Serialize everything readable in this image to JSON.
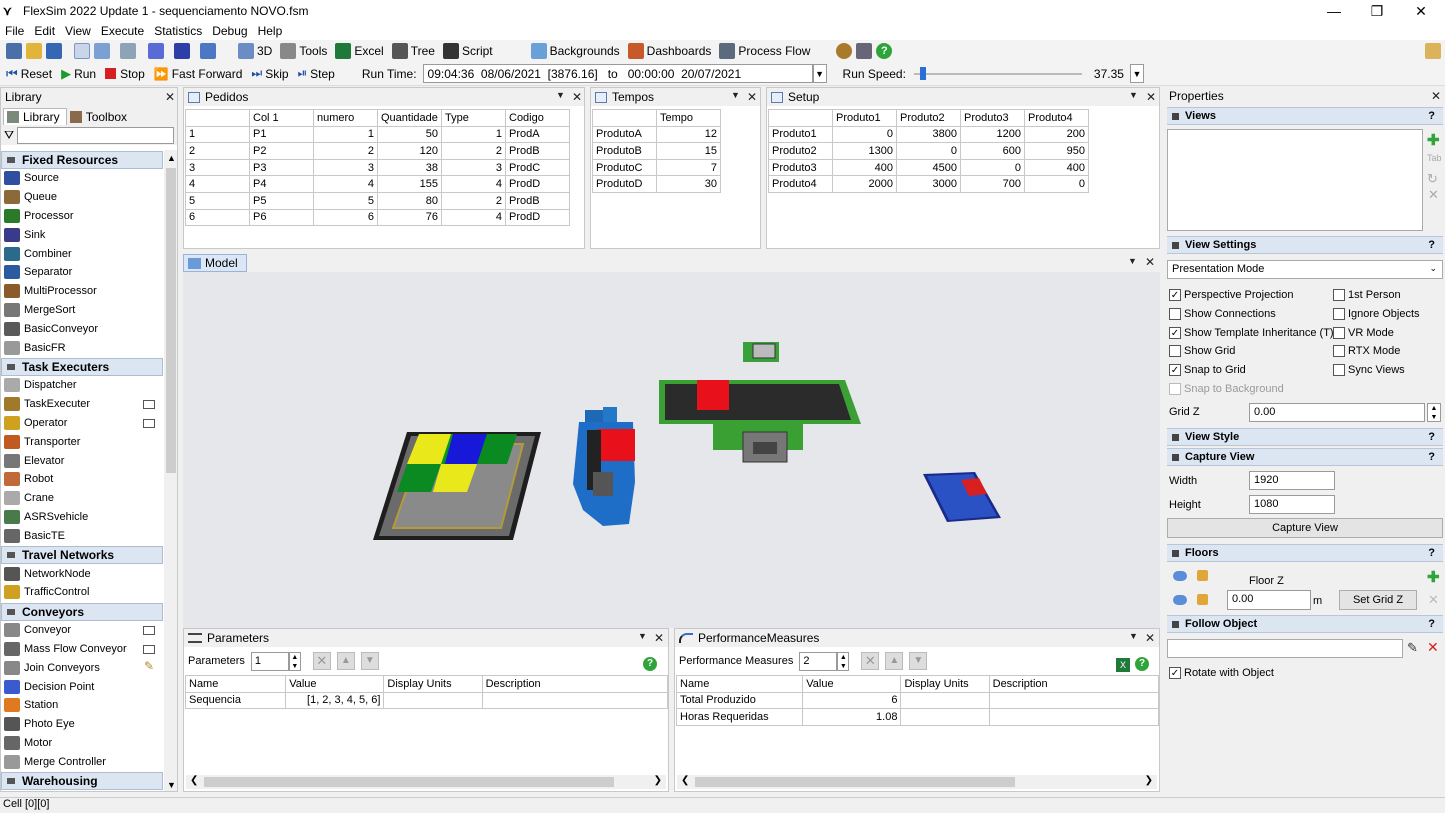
{
  "app": {
    "title": "FlexSim 2022 Update 1 - sequenciamento NOVO.fsm",
    "status": "Cell [0][0]"
  },
  "menu": [
    "File",
    "Edit",
    "View",
    "Execute",
    "Statistics",
    "Debug",
    "Help"
  ],
  "toolbar": {
    "btn_3d": "3D",
    "btn_tools": "Tools",
    "btn_excel": "Excel",
    "btn_tree": "Tree",
    "btn_script": "Script",
    "btn_backgrounds": "Backgrounds",
    "btn_dashboards": "Dashboards",
    "btn_process_flow": "Process Flow"
  },
  "runbar": {
    "reset": "Reset",
    "run": "Run",
    "stop": "Stop",
    "fast_forward": "Fast Forward",
    "skip": "Skip",
    "step": "Step",
    "run_time_label": "Run Time:",
    "run_time_value": "09:04:36  08/06/2021  [3876.16]   to   00:00:00  20/07/2021",
    "run_speed_label": "Run Speed:",
    "run_speed_value": "37.35",
    "run_speed_fraction": 0.04
  },
  "library": {
    "title": "Library",
    "tabs": [
      "Library",
      "Toolbox"
    ],
    "categories": [
      {
        "name": "Fixed Resources",
        "items": [
          "Source",
          "Queue",
          "Processor",
          "Sink",
          "Combiner",
          "Separator",
          "MultiProcessor",
          "MergeSort",
          "BasicConveyor",
          "BasicFR"
        ]
      },
      {
        "name": "Task Executers",
        "items": [
          "Dispatcher",
          "TaskExecuter",
          "Operator",
          "Transporter",
          "Elevator",
          "Robot",
          "Crane",
          "ASRSvehicle",
          "BasicTE"
        ]
      },
      {
        "name": "Travel Networks",
        "items": [
          "NetworkNode",
          "TrafficControl"
        ]
      },
      {
        "name": "Conveyors",
        "items": [
          "Conveyor",
          "Mass Flow Conveyor",
          "Join Conveyors",
          "Decision Point",
          "Station",
          "Photo Eye",
          "Motor",
          "Merge Controller"
        ]
      },
      {
        "name": "Warehousing",
        "items": []
      }
    ]
  },
  "pedidos": {
    "title": "Pedidos",
    "headers": [
      "",
      "Col 1",
      "numero",
      "Quantidade",
      "Type",
      "Codigo"
    ],
    "rows": [
      [
        "1",
        "P1",
        "1",
        "50",
        "1",
        "ProdA"
      ],
      [
        "2",
        "P2",
        "2",
        "120",
        "2",
        "ProdB"
      ],
      [
        "3",
        "P3",
        "3",
        "38",
        "3",
        "ProdC"
      ],
      [
        "4",
        "P4",
        "4",
        "155",
        "4",
        "ProdD"
      ],
      [
        "5",
        "P5",
        "5",
        "80",
        "2",
        "ProdB"
      ],
      [
        "6",
        "P6",
        "6",
        "76",
        "4",
        "ProdD"
      ]
    ]
  },
  "tempos": {
    "title": "Tempos",
    "headers": [
      "",
      "Tempo"
    ],
    "rows": [
      [
        "ProdutoA",
        "12"
      ],
      [
        "ProdutoB",
        "15"
      ],
      [
        "ProdutoC",
        "7"
      ],
      [
        "ProdutoD",
        "30"
      ]
    ]
  },
  "setup": {
    "title": "Setup",
    "headers": [
      "",
      "Produto1",
      "Produto2",
      "Produto3",
      "Produto4"
    ],
    "rows": [
      [
        "Produto1",
        "0",
        "3800",
        "1200",
        "200"
      ],
      [
        "Produto2",
        "1300",
        "0",
        "600",
        "950"
      ],
      [
        "Produto3",
        "400",
        "4500",
        "0",
        "400"
      ],
      [
        "Produto4",
        "2000",
        "3000",
        "700",
        "0"
      ]
    ]
  },
  "model": {
    "title": "Model"
  },
  "parameters": {
    "title": "Parameters",
    "label": "Parameters",
    "count": "1",
    "headers": [
      "Name",
      "Value",
      "Display Units",
      "Description"
    ],
    "rows": [
      [
        "Sequencia",
        "[1, 2, 3, 4, 5, 6]",
        "",
        ""
      ]
    ]
  },
  "performance": {
    "title": "PerformanceMeasures",
    "label": "Performance Measures",
    "count": "2",
    "headers": [
      "Name",
      "Value",
      "Display Units",
      "Description"
    ],
    "rows": [
      [
        "Total Produzido",
        "6",
        "",
        ""
      ],
      [
        "Horas Requeridas",
        "1.08",
        "",
        ""
      ]
    ]
  },
  "properties": {
    "title": "Properties",
    "views": "Views",
    "view_settings": "View Settings",
    "mode": "Presentation Mode",
    "checks_left": [
      {
        "label": "Perspective Projection",
        "checked": true
      },
      {
        "label": "Show Connections",
        "checked": false
      },
      {
        "label": "Show Template Inheritance (T)",
        "checked": true
      },
      {
        "label": "Show Grid",
        "checked": false
      },
      {
        "label": "Snap to Grid",
        "checked": true
      },
      {
        "label": "Snap to Background",
        "checked": false
      }
    ],
    "checks_right": [
      {
        "label": "1st Person",
        "checked": false
      },
      {
        "label": "Ignore Objects",
        "checked": false
      },
      {
        "label": "VR Mode",
        "checked": false
      },
      {
        "label": "RTX Mode",
        "checked": false
      },
      {
        "label": "Sync Views",
        "checked": false
      }
    ],
    "grid_z_label": "Grid Z",
    "grid_z": "0.00",
    "view_style": "View Style",
    "capture_view": "Capture View",
    "width_label": "Width",
    "width": "1920",
    "height_label": "Height",
    "height": "1080",
    "capture_button": "Capture View",
    "floors": "Floors",
    "floor_z": "Floor Z",
    "floor_value": "0.00",
    "floor_unit": "m",
    "set_grid_z": "Set Grid Z",
    "follow_object": "Follow Object",
    "rotate_with_object": "Rotate with Object"
  }
}
